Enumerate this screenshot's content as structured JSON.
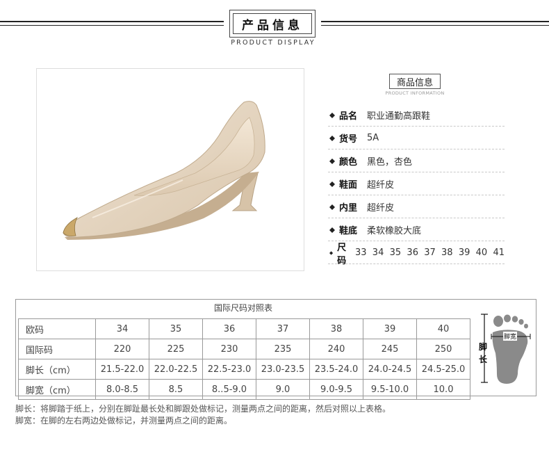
{
  "header": {
    "title": "产品信息",
    "subtitle": "PRODUCT  DISPLAY"
  },
  "info": {
    "title": "商品信息",
    "subtitle": "PRODUCT INFORMATION",
    "rows": [
      {
        "key": "品名",
        "value": "职业通勤高跟鞋"
      },
      {
        "key": "货号",
        "value": "5A"
      },
      {
        "key": "颜色",
        "value": "黑色，杏色"
      },
      {
        "key": "鞋面",
        "value": "超纤皮"
      },
      {
        "key": "内里",
        "value": "超纤皮"
      },
      {
        "key": "鞋底",
        "value": "柔软橡胶大底"
      },
      {
        "key": "尺码",
        "value": "33  34  35  36  37  38  39  40  41"
      }
    ]
  },
  "size_table": {
    "title": "国际尺码对照表",
    "rows": [
      {
        "label": "欧码",
        "cells": [
          "34",
          "35",
          "36",
          "37",
          "38",
          "39",
          "40"
        ]
      },
      {
        "label": "国际码",
        "cells": [
          "220",
          "225",
          "230",
          "235",
          "240",
          "245",
          "250"
        ]
      },
      {
        "label": "脚长（cm）",
        "cells": [
          "21.5-22.0",
          "22.0-22.5",
          "22.5-23.0",
          "23.0-23.5",
          "23.5-24.0",
          "24.0-24.5",
          "24.5-25.0"
        ]
      },
      {
        "label": "脚宽（cm）",
        "cells": [
          "8.0-8.5",
          "8.5",
          "8..5-9.0",
          "9.0",
          "9.0-9.5",
          "9.5-10.0",
          "10.0"
        ]
      }
    ],
    "foot_length_label": "脚长",
    "foot_width_label": "脚宽"
  },
  "notes": [
    "脚长：将脚踏于纸上，分别在脚趾最长处和脚跟处做标记，测量两点之间的距离，然后对照以上表格。",
    "脚宽：在脚的左右两边处做标记，并测量两点之间的距离。"
  ],
  "colors": {
    "accent": "#222222",
    "shoe_beige": "#e8d8c2",
    "foot_gray": "#8a8a8a"
  }
}
